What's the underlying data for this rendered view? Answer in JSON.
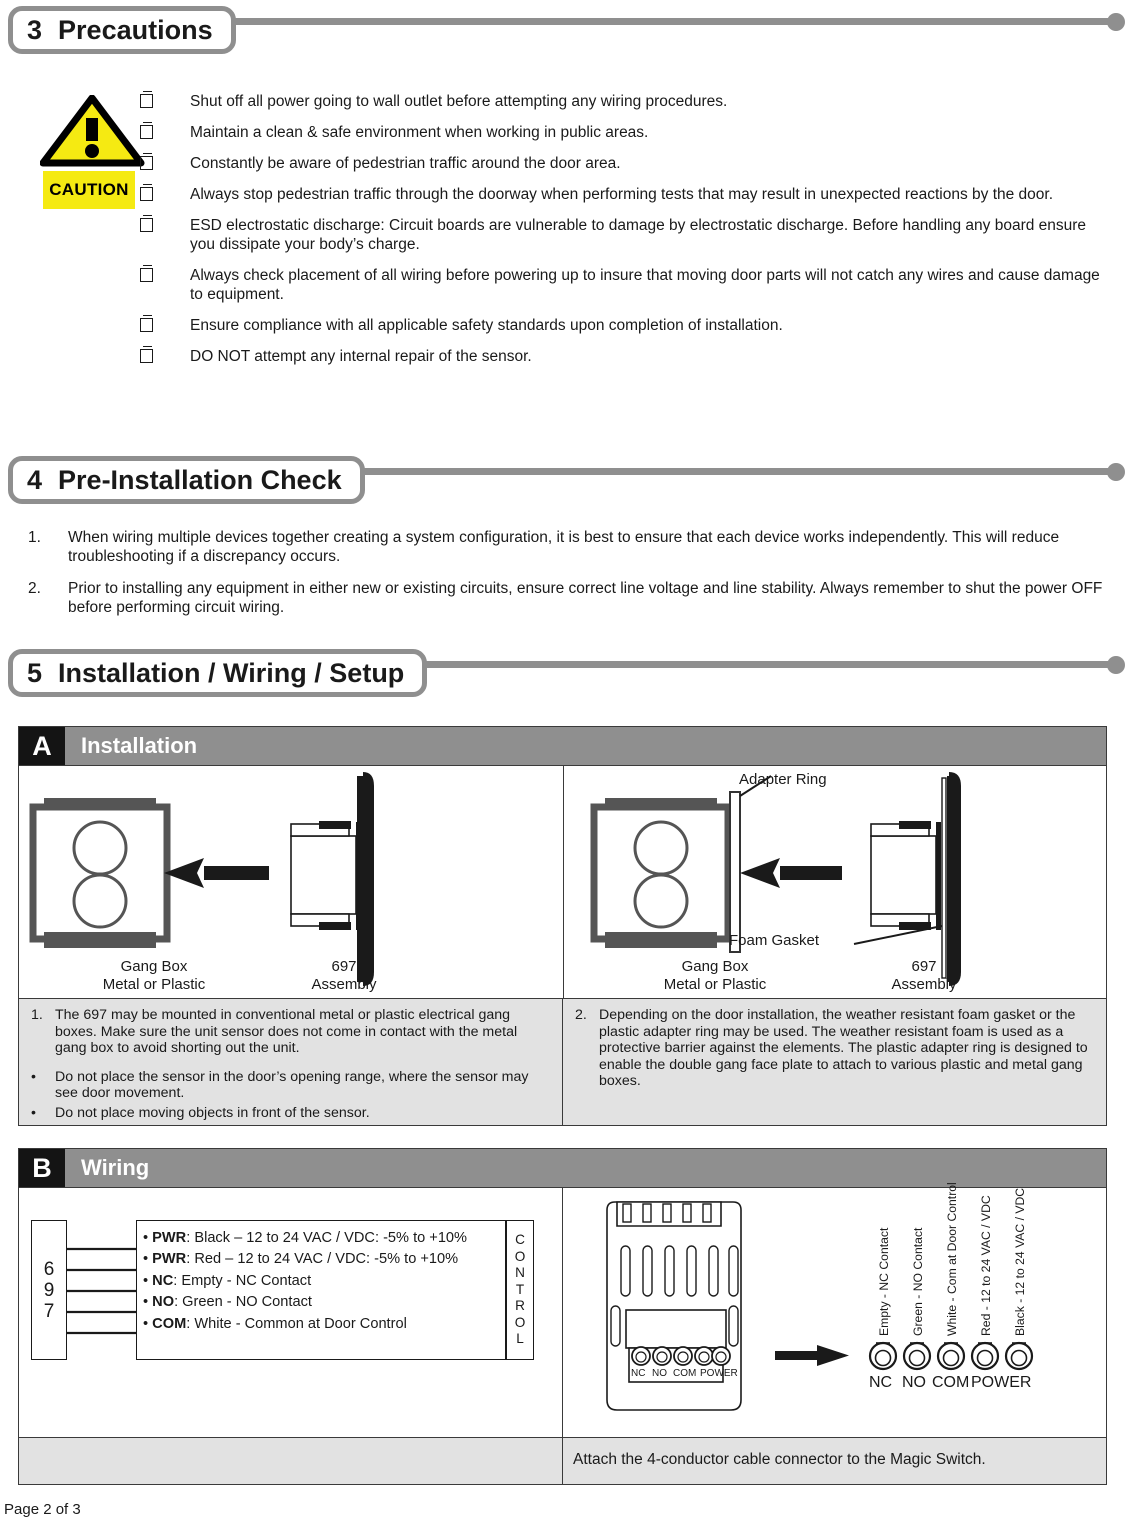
{
  "sections": [
    {
      "num": "3",
      "title": "Precautions"
    },
    {
      "num": "4",
      "title": "Pre-Installation Check"
    },
    {
      "num": "5",
      "title": "Installation / Wiring  / Setup"
    }
  ],
  "caution": {
    "label": "CAUTION"
  },
  "precautions": [
    "Shut off all power going to wall outlet before attempting any wiring procedures.",
    "Maintain a clean & safe environment when working in public areas.",
    "Constantly be aware of pedestrian traffic around the door area.",
    "Always stop pedestrian traffic through the doorway when performing tests that may result in unexpected reactions by the door.",
    "ESD electrostatic discharge: Circuit boards are vulnerable to damage by electrostatic discharge. Before handling any board ensure you dissipate your body’s charge.",
    "Always check placement of all wiring before powering up to insure that moving door parts will not catch any wires and cause damage to equipment.",
    "Ensure compliance with all applicable safety standards upon completion of installation.",
    "DO NOT attempt any internal repair of the sensor."
  ],
  "preinstall": [
    {
      "n": "1.",
      "text": "When wiring multiple devices together creating a system configuration, it is best to ensure that each device works independently.  This will reduce troubleshooting if a discrepancy occurs."
    },
    {
      "n": "2.",
      "text": "Prior to installing any equipment in either new or existing circuits, ensure correct line voltage and line stability. Always remember to shut the power OFF before performing circuit wiring."
    }
  ],
  "table_a": {
    "letter": "A",
    "title": "Installation",
    "left_diagram": {
      "gangbox_caption_line1": "Gang Box",
      "gangbox_caption_line2": "Metal or Plastic",
      "assembly_caption_line1": "697",
      "assembly_caption_line2": "Assembly"
    },
    "right_diagram": {
      "gangbox_caption_line1": "Gang Box",
      "gangbox_caption_line2": "Metal or Plastic",
      "assembly_caption_line1": "697",
      "assembly_caption_line2": "Assembly",
      "adapter_ring_label": "Adapter Ring",
      "foam_gasket_label": "Foam Gasket"
    },
    "left_notes": [
      {
        "mark": "1.",
        "text": "The 697 may be mounted in conventional metal or plastic electrical gang boxes.  Make sure the unit sensor does not come in contact with the metal gang box to avoid shorting out the unit.",
        "gap": false
      },
      {
        "mark": "•",
        "text": "Do not place the sensor in the door’s opening range, where the sensor may see door movement.",
        "gap": true
      },
      {
        "mark": "•",
        "text": "Do not place moving objects in front of the sensor.",
        "gap": false
      }
    ],
    "right_notes": [
      {
        "mark": "2.",
        "text": "Depending on the door installation, the weather resistant foam gasket or the plastic adapter ring may be used.  The weather resistant foam is used as a protective barrier against the elements. The plastic adapter ring is designed to enable the double gang face plate to attach to various plastic and metal gang boxes.",
        "gap": false
      }
    ]
  },
  "table_b": {
    "letter": "B",
    "title": "Wiring",
    "device_label_digits": [
      "6",
      "9",
      "7"
    ],
    "control_label": "CONTROL",
    "wires": [
      {
        "term": "PWR",
        "desc": ": Black – 12 to 24  VAC / VDC: -5%  to +10%"
      },
      {
        "term": "PWR",
        "desc": ": Red – 12 to 24  VAC / VDC: -5%  to +10%"
      },
      {
        "term": "NC",
        "desc": ": Empty - NC Contact"
      },
      {
        "term": "NO",
        "desc": ": Green - NO Contact"
      },
      {
        "term": "COM",
        "desc": ": White - Common at Door Control"
      }
    ],
    "device_terminals": [
      "NC",
      "NO",
      "COM",
      "POWER"
    ],
    "terminal_detail": {
      "labels": [
        "Empty - NC Contact",
        "Green - NO Contact",
        "White - Com at Door Control",
        "Red - 12 to 24  VAC / VDC",
        "Black - 12 to 24  VAC / VDC"
      ],
      "terminals": [
        "NC",
        "NO",
        "COM",
        "POWER"
      ]
    },
    "note": "Attach the 4-conductor cable connector to the Magic Switch."
  },
  "footer": {
    "page": "Page 2 of 3"
  },
  "colors": {
    "rail": "#8f8f8f",
    "header_bar": "#8f8f8f",
    "note_bg": "#e2e2e2",
    "caution_yellow": "#f5ea12",
    "ink": "#1a1a1a"
  }
}
